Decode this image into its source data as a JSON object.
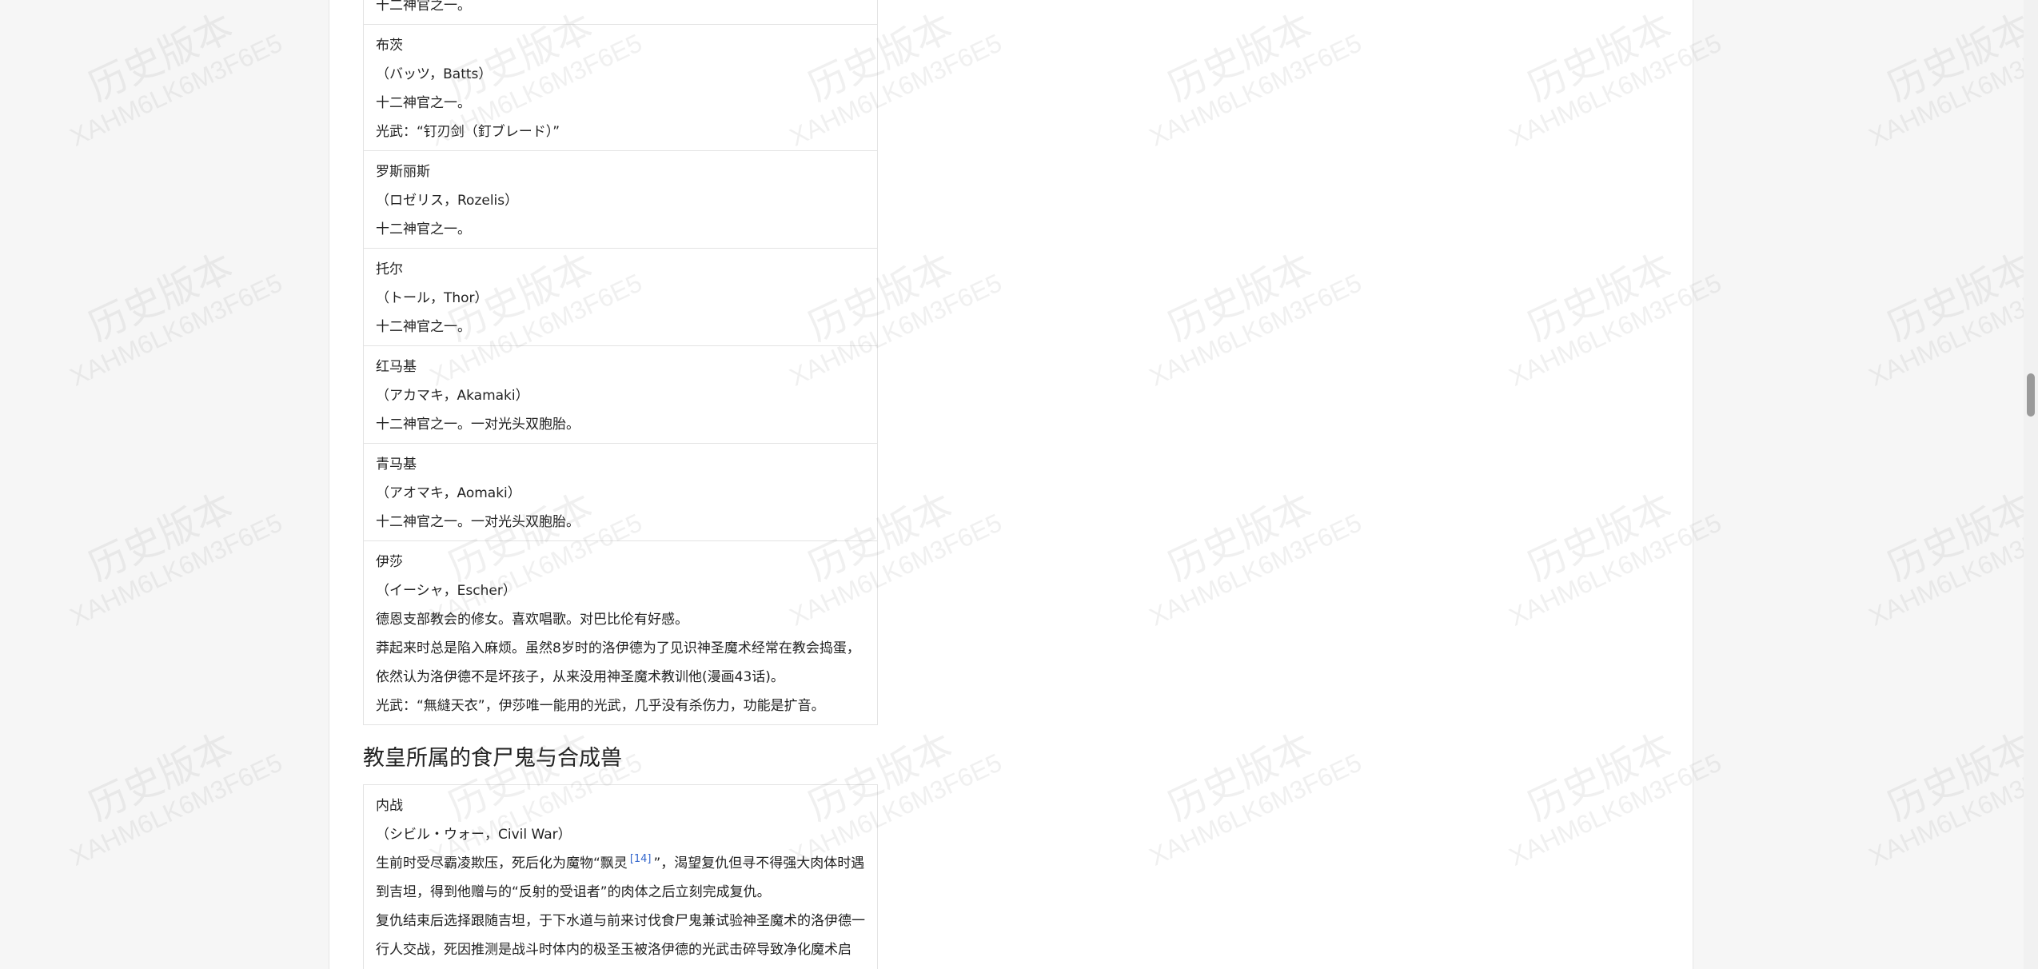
{
  "top_table": {
    "entries": [
      {
        "lines": [
          "十二神官之一。"
        ]
      },
      {
        "lines": [
          "布茨",
          "（バッツ，Batts）",
          "十二神官之一。",
          "光武：“钉刃剑（釘ブレード）”"
        ]
      },
      {
        "lines": [
          "罗斯丽斯",
          "（ロゼリス，Rozelis）",
          "十二神官之一。"
        ]
      },
      {
        "lines": [
          "托尔",
          "（トール，Thor）",
          "十二神官之一。"
        ]
      },
      {
        "lines": [
          "红马基",
          "（アカマキ，Akamaki）",
          "十二神官之一。一对光头双胞胎。"
        ]
      },
      {
        "lines": [
          "青马基",
          "（アオマキ，Aomaki）",
          "十二神官之一。一对光头双胞胎。"
        ]
      },
      {
        "lines": [
          "伊莎",
          "（イーシャ，Escher）",
          "德恩支部教会的修女。喜欢唱歌。对巴比伦有好感。",
          "莽起来时总是陷入麻烦。虽然8岁时的洛伊德为了见识神圣魔术经常在教会捣蛋，依然认为洛伊德不是坏孩子，从来没用神圣魔术教训他(漫画43话)。",
          "光武：“無縫天衣”，伊莎唯一能用的光武，几乎没有杀伤力，功能是扩音。"
        ]
      }
    ]
  },
  "section": {
    "title": "教皇所属的食尸鬼与合成兽"
  },
  "bottom_table": {
    "name": "内战",
    "reading": "（シビル・ウォー，Civil War）",
    "desc1_before": "生前时受尽霸凌欺压，死后化为魔物“飘灵",
    "desc1_ref": "[14]",
    "desc1_after": "”，渴望复仇但寻不得强大肉体时遇到吉坦，得到他赠与的“反射的受诅者”的肉体之后立刻完成复仇。",
    "desc2": "复仇结束后选择跟随吉坦，于下水道与前来讨伐食尸鬼兼试验神圣魔术的洛伊德一行人交战，死因推测是战斗时体内的极圣玉被洛伊德的光武击碎导致净化魔术启动，化为粉末。"
  },
  "watermark": {
    "line1": "历史版本",
    "line2": "XAHM6LK6M3F6E5"
  }
}
